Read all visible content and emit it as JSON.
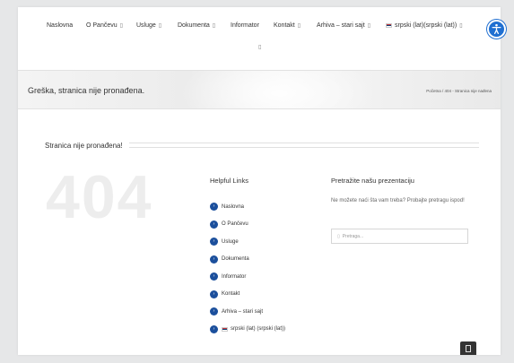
{
  "nav": {
    "items": [
      {
        "label": "Naslovna",
        "caret": false
      },
      {
        "label": "O Pančevu",
        "caret": true
      },
      {
        "label": "Usluge",
        "caret": true
      },
      {
        "label": "Dokumenta",
        "caret": true
      },
      {
        "label": "Informator",
        "caret": false
      },
      {
        "label": "Kontakt",
        "caret": true
      },
      {
        "label": "Arhiva – stari sajt",
        "caret": true
      },
      {
        "label": "srpski (lat)(srpski (lat))",
        "caret": true
      }
    ],
    "caret_glyph": "▯",
    "accessibility_icon": "accessibility-icon"
  },
  "title_bar": {
    "title": "Greška, stranica nije pronađena.",
    "breadcrumb": "Početna / 404 - Stranica nije nađena"
  },
  "content": {
    "section_heading": "Stranica nije pronađena!",
    "big_code": "404",
    "helpful_links": {
      "title": "Helpful Links",
      "items": [
        "Naslovna",
        "O Pančevu",
        "Usluge",
        "Dokumenta",
        "Informator",
        "Kontakt",
        "Arhiva – stari sajt",
        "srpski (lat) (srpski (lat))"
      ]
    },
    "search": {
      "title": "Pretražite našu prezentaciju",
      "text": "Ne možete naći šta vam treba? Probajte pretragu ispod!",
      "placeholder": "Pretraga..."
    }
  },
  "colors": {
    "accent_blue": "#1b4f9c",
    "accessibility_blue": "#1f6fd1",
    "flag_red": "#c6363c",
    "flag_blue": "#0c4076"
  }
}
